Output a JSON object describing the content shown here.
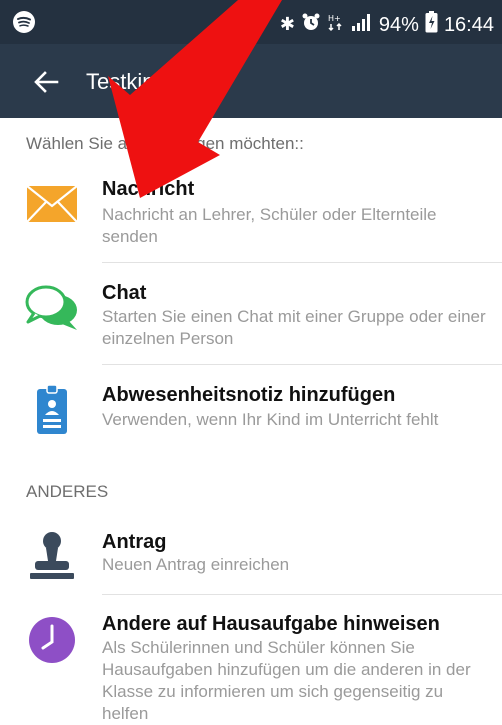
{
  "status_bar": {
    "time": "16:44",
    "battery": "94%",
    "icons": [
      "spotify-icon",
      "bluetooth-icon",
      "alarm-icon",
      "data-icon",
      "signal-icon",
      "battery-icon"
    ]
  },
  "app_bar": {
    "title": "Testkin",
    "back_icon": "arrow-left-icon"
  },
  "prompt": "Wählen Sie au           hinzufügen möchten::",
  "items": [
    {
      "icon": "envelope-icon",
      "title": "Nachricht",
      "desc": "Nachricht an Lehrer, Schüler oder Elternteile senden"
    },
    {
      "icon": "chat-bubbles-icon",
      "title": "Chat",
      "desc": "Starten Sie einen Chat mit einer Gruppe oder einer einzelnen Person"
    },
    {
      "icon": "badge-icon",
      "title": "Abwesenheitsnotiz hinzufügen",
      "desc": "Verwenden, wenn Ihr Kind im Unterricht fehlt"
    }
  ],
  "section_other": "ANDERES",
  "other_items": [
    {
      "icon": "stamp-icon",
      "title": "Antrag",
      "desc": "Neuen Antrag einreichen"
    },
    {
      "icon": "clock-icon",
      "title": "Andere auf Hausaufgabe hinweisen",
      "desc": "Als Schülerinnen und Schüler können Sie Hausaufgaben hinzufügen um die anderen in der Klasse zu informieren um sich gegenseitig zu helfen"
    }
  ],
  "colors": {
    "status_bar": "#243140",
    "app_bar": "#2b3a4b",
    "envelope": "#f4a52b",
    "chat": "#35b85a",
    "badge": "#2f86cf",
    "stamp": "#3b4a5c",
    "clock": "#8e4fc6",
    "annotation_arrow": "#ee1111"
  }
}
